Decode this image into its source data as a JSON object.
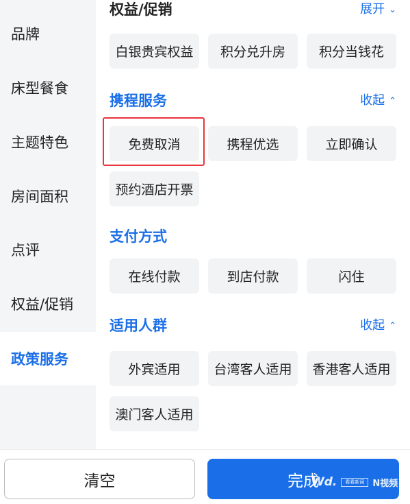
{
  "sidebar": {
    "items": [
      {
        "label": "品牌"
      },
      {
        "label": "床型餐食"
      },
      {
        "label": "主题特色"
      },
      {
        "label": "房间面积"
      },
      {
        "label": "点评"
      },
      {
        "label": "权益/促销"
      },
      {
        "label": "政策服务"
      }
    ],
    "active_index": 6
  },
  "sections": {
    "promotion": {
      "title": "权益/促销",
      "toggle_label": "展开",
      "toggle_icon": "chevron-down-icon",
      "chips": [
        "白银贵宾权益",
        "积分兑升房",
        "积分当钱花"
      ]
    },
    "ctrip_service": {
      "title": "携程服务",
      "toggle_label": "收起",
      "toggle_icon": "chevron-up-icon",
      "chips": [
        "免费取消",
        "携程优选",
        "立即确认",
        "预约酒店开票"
      ],
      "highlighted": "免费取消"
    },
    "payment": {
      "title": "支付方式",
      "chips": [
        "在线付款",
        "到店付款",
        "闪住"
      ]
    },
    "audience": {
      "title": "适用人群",
      "toggle_label": "收起",
      "toggle_icon": "chevron-up-icon",
      "chips": [
        "外宾适用",
        "台湾客人适用",
        "香港客人适用",
        "澳门客人适用"
      ]
    }
  },
  "footer": {
    "clear_label": "清空",
    "done_label": "完成"
  },
  "watermark": {
    "logo": "Wd.",
    "box_text": "看看新闻",
    "n_text": "N视频"
  },
  "colors": {
    "accent": "#1a6fe8",
    "highlight_border": "#e8343a",
    "chip_bg": "#f2f3f5",
    "sidebar_bg": "#f4f5f7"
  }
}
